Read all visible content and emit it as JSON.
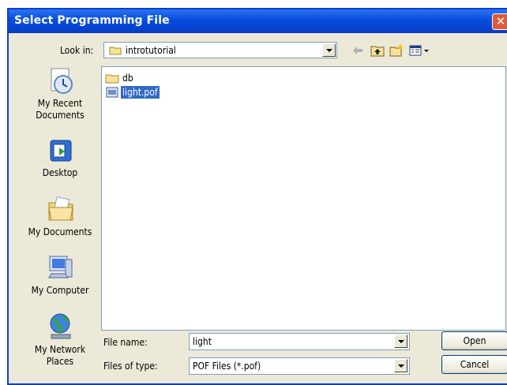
{
  "dialog": {
    "title": "Select Programming File",
    "close_symbol": "✕"
  },
  "lookin": {
    "label": "Look in:",
    "value": "introtutorial"
  },
  "places": [
    {
      "label": "My Recent\nDocuments",
      "icon": "recent-documents-icon"
    },
    {
      "label": "Desktop",
      "icon": "desktop-icon"
    },
    {
      "label": "My Documents",
      "icon": "my-documents-icon"
    },
    {
      "label": "My Computer",
      "icon": "my-computer-icon"
    },
    {
      "label": "My Network\nPlaces",
      "icon": "network-places-icon"
    }
  ],
  "files": [
    {
      "name": "db",
      "type": "folder",
      "selected": false
    },
    {
      "name": "light.pof",
      "type": "file",
      "selected": true
    }
  ],
  "filename": {
    "label": "File name:",
    "value": "light"
  },
  "filetype": {
    "label": "Files of type:",
    "value": "POF Files (*.pof)"
  },
  "buttons": {
    "open": "Open",
    "cancel": "Cancel"
  },
  "colors": {
    "titlebar": "#0a4fe0",
    "selection": "#316ac5",
    "dialog_bg": "#ece9d8"
  }
}
